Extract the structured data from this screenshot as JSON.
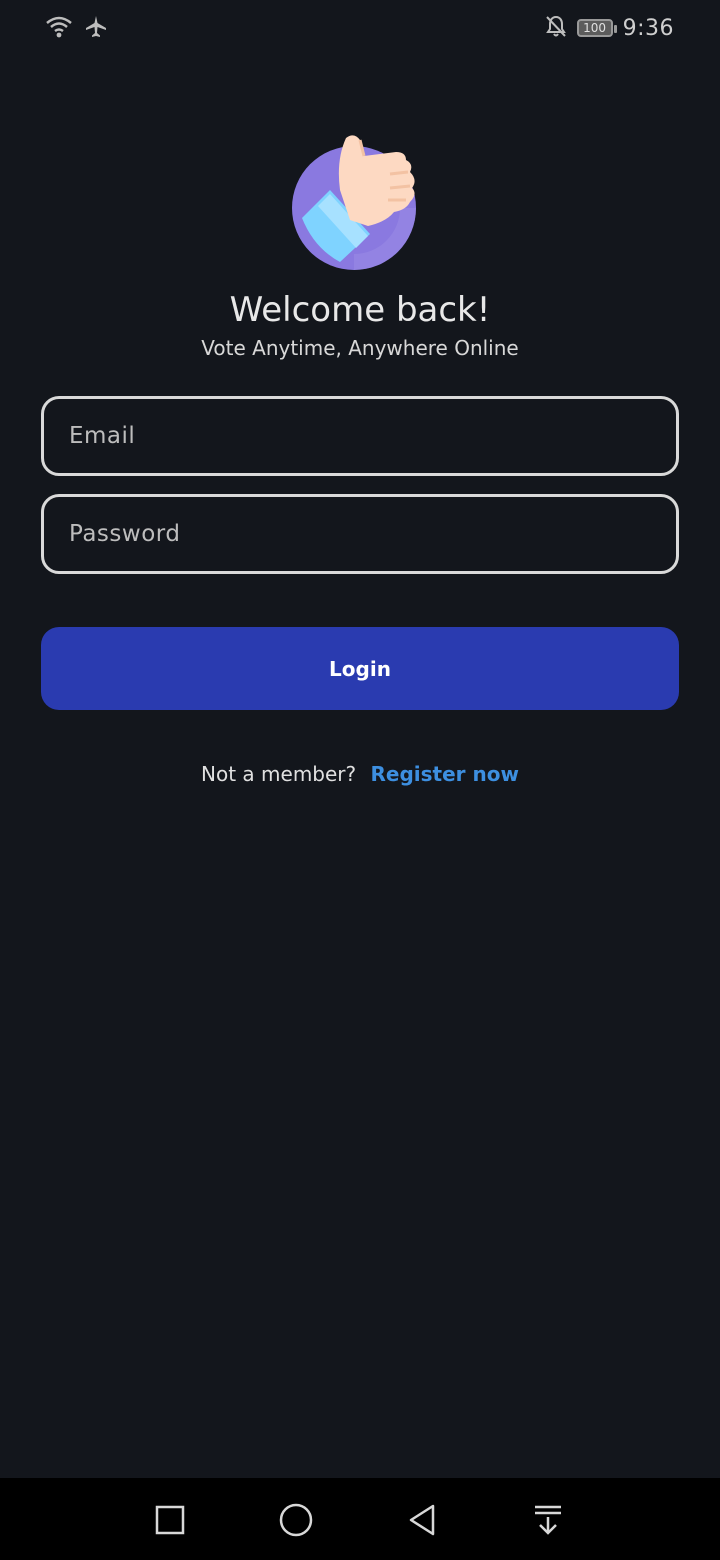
{
  "status_bar": {
    "time": "9:36",
    "battery": "100",
    "icons": [
      "wifi-icon",
      "airplane-mode-icon",
      "notifications-off-icon",
      "battery-icon"
    ]
  },
  "hero": {
    "logo_icon": "thumbs-up-icon",
    "title": "Welcome back!",
    "subtitle": "Vote Anytime, Anywhere Online"
  },
  "form": {
    "email_placeholder": "Email",
    "email_value": "",
    "password_placeholder": "Password",
    "password_value": "",
    "login_label": "Login"
  },
  "register": {
    "prompt": "Not a member?",
    "link": "Register now"
  },
  "nav_bar": {
    "icons": [
      "recents-square-icon",
      "home-circle-icon",
      "back-triangle-icon",
      "notification-pull-icon"
    ]
  },
  "colors": {
    "background": "#13161c",
    "primary_button": "#2a3bb0",
    "link": "#3d8fe0",
    "field_border": "#d9d9d9"
  }
}
